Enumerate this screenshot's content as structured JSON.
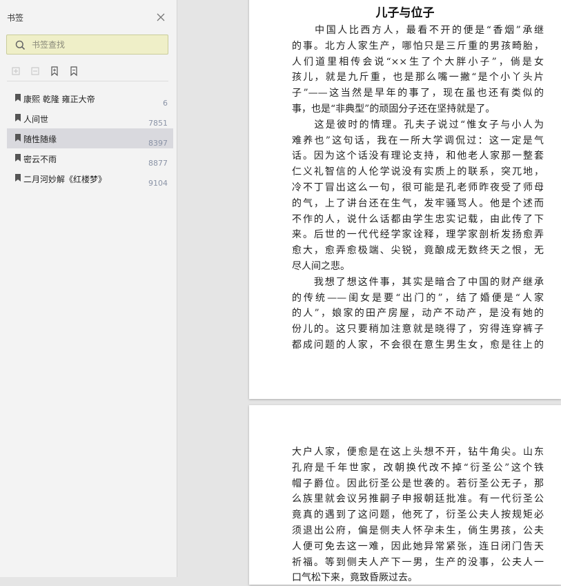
{
  "sidebar": {
    "title": "书签",
    "search_placeholder": "书签查找",
    "bookmarks": [
      {
        "label": "康熙 乾隆 雍正大帝",
        "page": "6"
      },
      {
        "label": "人间世",
        "page": "7851"
      },
      {
        "label": "随性随缘",
        "page": "8397"
      },
      {
        "label": "密云不雨",
        "page": "8877"
      },
      {
        "label": "二月河妙解《红楼梦》",
        "page": "9104"
      }
    ]
  },
  "document": {
    "title": "儿子与位子",
    "page1_lines": [
      "　　中国人比西方人，最看不开的便是“香烟”承继",
      "的事。北方人家生产，哪怕只是三斤重的男孩畸胎，",
      "人们道里相传会说“××生了个大胖小子”，倘是女",
      "孩儿，就是九斤重，也是那么嘴一撇“是个小丫头片",
      "子”——这当然是早年的事了，现在虽也还有类似的",
      "事，也是“非典型”的顽固分子还在坚持就是了。",
      "　　这是彼时的情理。孔夫子说过“惟女子与小人为",
      "难养也”这句话，我在一所大学调侃过：这一定是气",
      "话。因为这个话没有理论支持，和他老人家那一整套",
      "仁义礼智信的人伦学说没有实质上的联系，突兀地，",
      "冷不丁冒出这么一句，很可能是孔老师昨夜受了师母",
      "的气，上了讲台还在生气，发牢骚骂人。他是个述而",
      "不作的人，说什么话都由学生忠实记载，由此传了下",
      "来。后世的一代代经学家诠释，理学家剖析发扬愈弄",
      "愈大，愈弄愈极端、尖锐，竟酿成无数终天之恨，无",
      "尽人间之悲。",
      "　　我想了想这件事，其实是暗合了中国的财产继承",
      "的传统——闺女是要“出门的”，结了婚便是“人家",
      "的人”，娘家的田产房屋，动产不动产，是没有她的",
      "份儿的。这只要稍加注意就是晓得了，穷得连穿裤子",
      "都成问题的人家，不会很在意生男生女，愈是往上的"
    ],
    "page2_lines": [
      "大户人家，便愈是在这上头想不开，钻牛角尖。山东",
      "孔府是千年世家，改朝换代改不掉“衍圣公”这个铁",
      "帽子爵位。因此衍圣公是世袭的。若衍圣公无子，那",
      "么族里就会议另推嗣子申报朝廷批准。有一代衍圣公",
      "竟真的遇到了这问题，他死了，衍圣公夫人按规矩必",
      "须退出公府，偏是侧夫人怀孕未生，倘生男孩，公夫",
      "人便可免去这一难，因此她异常紧张，连日闭门告天",
      "祈福。等到侧夫人产下一男，生产的没事，公夫人一",
      "口气松下来，竟致昏厥过去。"
    ]
  }
}
